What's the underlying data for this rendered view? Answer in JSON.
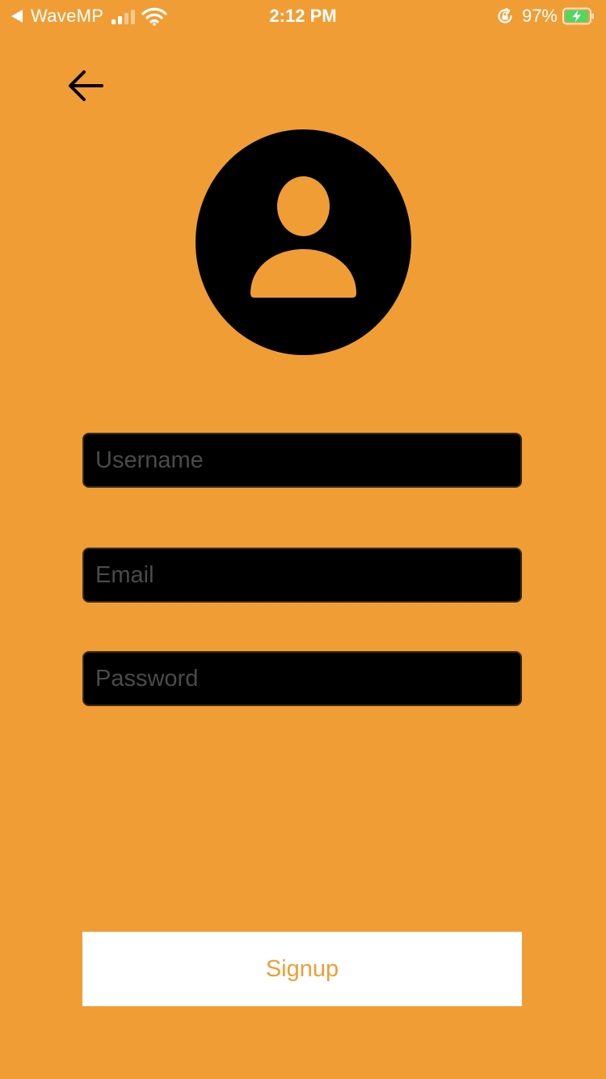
{
  "status_bar": {
    "back_app_label": "WaveMP",
    "time": "2:12 PM",
    "battery_percent": "97%",
    "signal_bars_active": 2,
    "signal_bars_total": 4,
    "battery_level": 0.97,
    "charging": true
  },
  "nav": {
    "back_icon": "arrow-left-icon"
  },
  "avatar": {
    "icon": "user-avatar-icon"
  },
  "form": {
    "username_placeholder": "Username",
    "username_value": "",
    "email_placeholder": "Email",
    "email_value": "",
    "password_placeholder": "Password",
    "password_value": ""
  },
  "signup_button_label": "Signup",
  "colors": {
    "background": "#F09D36",
    "field_background": "#000000",
    "placeholder": "#4A4A4A",
    "button_background": "#FFFFFF",
    "button_text": "#F09D36",
    "battery_fill": "#4CD964"
  }
}
